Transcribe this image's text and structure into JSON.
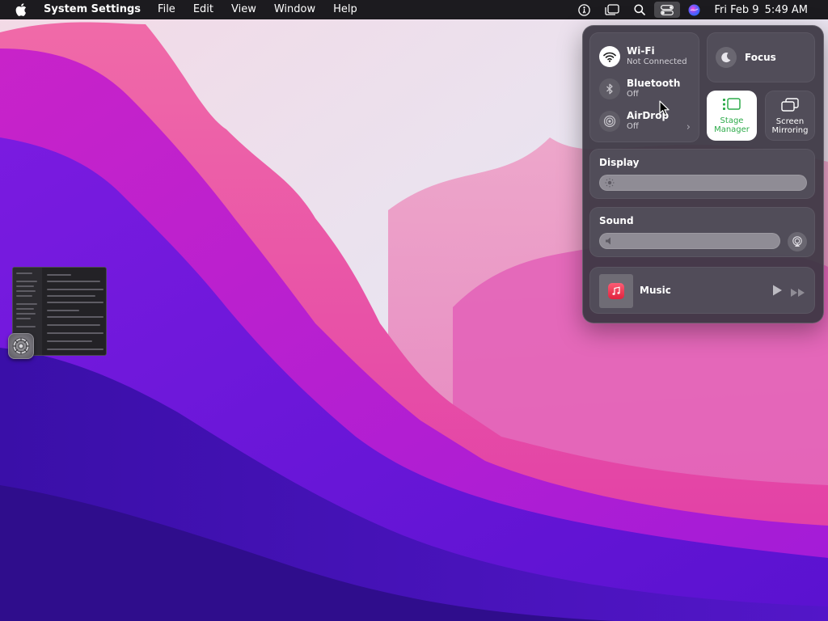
{
  "menubar": {
    "app_name": "System Settings",
    "menus": [
      "File",
      "Edit",
      "View",
      "Window",
      "Help"
    ],
    "status_icons": [
      "accessibility-icon",
      "stage-manager-icon",
      "search-icon",
      "control-center-icon",
      "siri-icon"
    ],
    "date": "Fri Feb 9",
    "time": "5:49 AM"
  },
  "control_center": {
    "network": {
      "wifi": {
        "label": "Wi-Fi",
        "status": "Not Connected",
        "icon": "wifi-icon"
      },
      "bluetooth": {
        "label": "Bluetooth",
        "status": "Off",
        "icon": "bluetooth-icon"
      },
      "airdrop": {
        "label": "AirDrop",
        "status": "Off",
        "icon": "airdrop-icon"
      }
    },
    "focus": {
      "label": "Focus",
      "icon": "moon-icon"
    },
    "stage_manager": {
      "line1": "Stage",
      "line2": "Manager",
      "active": true,
      "active_color": "#2dab4a"
    },
    "screen_mirroring": {
      "line1": "Screen",
      "line2": "Mirroring"
    },
    "display": {
      "label": "Display",
      "level": 0.0
    },
    "sound": {
      "label": "Sound",
      "level": 0.0
    },
    "music": {
      "label": "Music",
      "icon": "music-app-icon"
    }
  },
  "stage_manager_strip": {
    "app": "System Settings",
    "icon": "system-settings-icon"
  },
  "colors": {
    "menubar_bg": "#1c1b1f",
    "panel_bg": "#3a3642",
    "stage_active": "#2dab4a",
    "music_red": "#e1233e"
  }
}
